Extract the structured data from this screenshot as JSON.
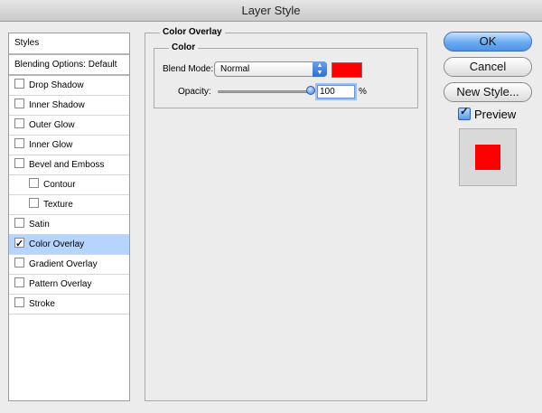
{
  "window": {
    "title": "Layer Style"
  },
  "styles_panel": {
    "header": "Styles",
    "blending": "Blending Options: Default",
    "items": [
      {
        "label": "Drop Shadow",
        "checked": false,
        "sub": false,
        "selected": false
      },
      {
        "label": "Inner Shadow",
        "checked": false,
        "sub": false,
        "selected": false
      },
      {
        "label": "Outer Glow",
        "checked": false,
        "sub": false,
        "selected": false
      },
      {
        "label": "Inner Glow",
        "checked": false,
        "sub": false,
        "selected": false
      },
      {
        "label": "Bevel and Emboss",
        "checked": false,
        "sub": false,
        "selected": false
      },
      {
        "label": "Contour",
        "checked": false,
        "sub": true,
        "selected": false
      },
      {
        "label": "Texture",
        "checked": false,
        "sub": true,
        "selected": false
      },
      {
        "label": "Satin",
        "checked": false,
        "sub": false,
        "selected": false
      },
      {
        "label": "Color Overlay",
        "checked": true,
        "sub": false,
        "selected": true
      },
      {
        "label": "Gradient Overlay",
        "checked": false,
        "sub": false,
        "selected": false
      },
      {
        "label": "Pattern Overlay",
        "checked": false,
        "sub": false,
        "selected": false
      },
      {
        "label": "Stroke",
        "checked": false,
        "sub": false,
        "selected": false
      }
    ]
  },
  "overlay": {
    "section_title": "Color Overlay",
    "group_title": "Color",
    "blend_mode_label": "Blend Mode:",
    "blend_mode_value": "Normal",
    "overlay_color": "#ff0000",
    "opacity_label": "Opacity:",
    "opacity_value": "100",
    "opacity_unit": "%"
  },
  "buttons": {
    "ok": "OK",
    "cancel": "Cancel",
    "new_style": "New Style...",
    "preview_label": "Preview",
    "preview_checked": true
  },
  "colors": {
    "accent": "#4f93e8",
    "selection": "#b5d5ff"
  }
}
